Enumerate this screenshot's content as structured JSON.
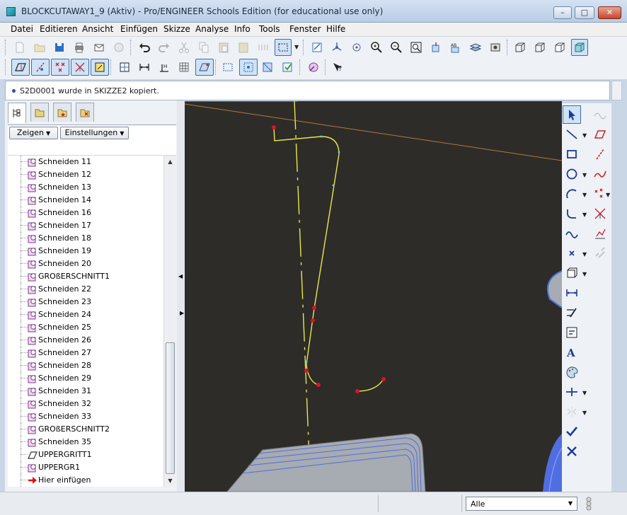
{
  "window": {
    "title": "BLOCKCUTAWAY1_9 (Aktiv) - Pro/ENGINEER Schools Edition (for educational use only)",
    "minimize_label": "–",
    "maximize_label": "□",
    "close_label": "✕"
  },
  "menu": [
    "Datei",
    "Editieren",
    "Ansicht",
    "Einfügen",
    "Skizze",
    "Analyse",
    "Info",
    "Tools",
    "Fenster",
    "Hilfe"
  ],
  "message": {
    "text": "S2D0001 wurde in SKIZZE2 kopiert."
  },
  "left_panel": {
    "show_button": "Zeigen",
    "settings_button": "Einstellungen",
    "tree_items": [
      {
        "label": "Schneiden 11",
        "icon": "cut-feature-icon"
      },
      {
        "label": "Schneiden 12",
        "icon": "cut-feature-icon"
      },
      {
        "label": "Schneiden 13",
        "icon": "cut-feature-icon"
      },
      {
        "label": "Schneiden 14",
        "icon": "cut-feature-icon"
      },
      {
        "label": "Schneiden 16",
        "icon": "cut-feature-icon"
      },
      {
        "label": "Schneiden 17",
        "icon": "cut-feature-icon"
      },
      {
        "label": "Schneiden 18",
        "icon": "cut-feature-icon"
      },
      {
        "label": "Schneiden 19",
        "icon": "cut-feature-icon"
      },
      {
        "label": "Schneiden 20",
        "icon": "cut-feature-icon"
      },
      {
        "label": "GROßERSCHNITT1",
        "icon": "cut-feature-icon"
      },
      {
        "label": "Schneiden 22",
        "icon": "cut-feature-icon"
      },
      {
        "label": "Schneiden 23",
        "icon": "cut-feature-icon"
      },
      {
        "label": "Schneiden 24",
        "icon": "cut-feature-icon"
      },
      {
        "label": "Schneiden 25",
        "icon": "cut-feature-icon"
      },
      {
        "label": "Schneiden 26",
        "icon": "cut-feature-icon"
      },
      {
        "label": "Schneiden 27",
        "icon": "cut-feature-icon"
      },
      {
        "label": "Schneiden 28",
        "icon": "cut-feature-icon"
      },
      {
        "label": "Schneiden 29",
        "icon": "cut-feature-icon"
      },
      {
        "label": "Schneiden 31",
        "icon": "cut-feature-icon"
      },
      {
        "label": "Schneiden 32",
        "icon": "cut-feature-icon"
      },
      {
        "label": "Schneiden 33",
        "icon": "cut-feature-icon"
      },
      {
        "label": "GROßERSCHNITT2",
        "icon": "cut-feature-icon"
      },
      {
        "label": "Schneiden 35",
        "icon": "cut-feature-icon"
      },
      {
        "label": "UPPERGRITT1",
        "icon": "datum-plane-icon"
      },
      {
        "label": "UPPERGR1",
        "icon": "cut-feature-icon"
      },
      {
        "label": "Hier einfügen",
        "icon": "insert-here-arrow-icon"
      }
    ]
  },
  "status": {
    "filter_value": "Alle"
  },
  "colors": {
    "graphics_bg": "#2e2c28",
    "sketch_line": "#e8e84a",
    "sketch_point": "#e0102a",
    "model_gray": "#a7abb2",
    "model_edge": "#4f6ee0",
    "datum_line": "#b07a3a"
  }
}
